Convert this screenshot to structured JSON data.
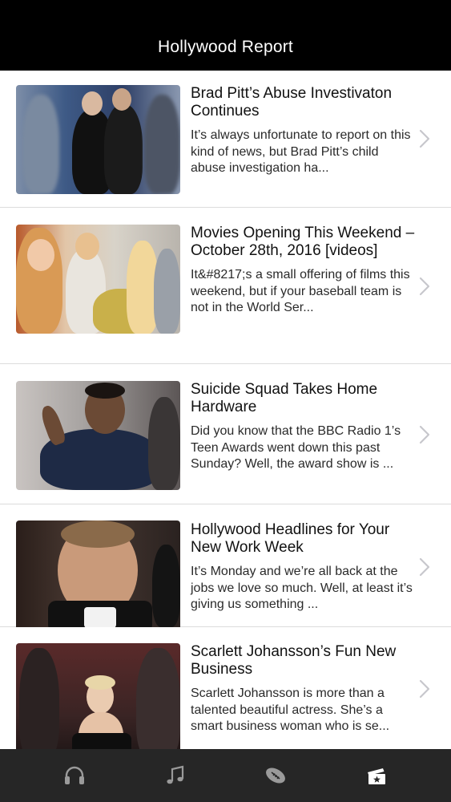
{
  "navbar": {
    "title": "Hollywood Report"
  },
  "articles": [
    {
      "headline": "Brad Pitt’s Abuse Investivaton Continues",
      "summary": "It’s always unfortunate to report on this kind of news, but Brad Pitt’s child abuse investigation ha..."
    },
    {
      "headline": "Movies Opening This Weekend – October 28th, 2016 [videos]",
      "summary": "It&#8217;s a small offering of films this weekend, but if your baseball team is not in the World Ser..."
    },
    {
      "headline": "Suicide Squad Takes Home Hardware",
      "summary": "Did you know that the BBC Radio 1’s Teen Awards went down this past Sunday? Well, the award show is ..."
    },
    {
      "headline": "Hollywood Headlines for Your New Work Week",
      "summary": "It’s Monday and we’re all back at the jobs we love so much. Well, at least it’s giving us something ..."
    },
    {
      "headline": "Scarlett Johansson’s Fun New Business",
      "summary": "Scarlett Johansson is more than a talented beautiful actress. She’s a smart business woman who is se..."
    }
  ],
  "tabbar": {
    "tabs": [
      {
        "icon": "headphones-icon",
        "active": false
      },
      {
        "icon": "music-note-icon",
        "active": false
      },
      {
        "icon": "football-icon",
        "active": false
      },
      {
        "icon": "ticket-star-icon",
        "active": true
      }
    ]
  },
  "colors": {
    "navbar": "#000000",
    "tabbar": "#262626",
    "tab_icon": "#9a9a9a",
    "tab_icon_active": "#ffffff",
    "chevron": "#c7c7cc"
  }
}
